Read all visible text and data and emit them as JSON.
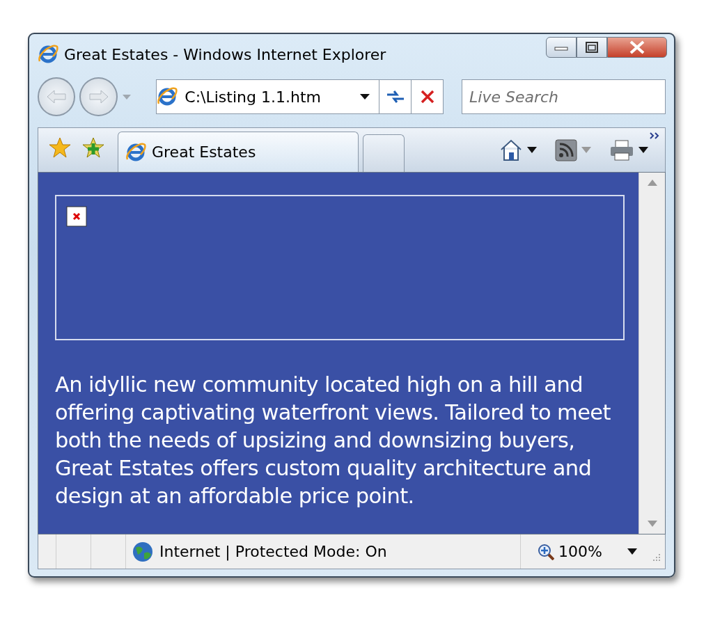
{
  "window": {
    "title": "Great Estates - Windows Internet Explorer"
  },
  "address": {
    "value": "C:\\Listing 1.1.htm"
  },
  "search": {
    "placeholder": "Live Search"
  },
  "tabs": [
    {
      "label": "Great Estates",
      "selected": true
    }
  ],
  "page": {
    "broken_image": true,
    "text": "An idyllic new community located high on a hill and offering captivating waterfront views. Tailored to meet both the needs of upsizing and downsizing buyers, Great Estates offers custom quality architecture and design at an affordable price point."
  },
  "status_bar": {
    "zone": "Internet | Protected Mode: On",
    "zoom": "100%"
  }
}
